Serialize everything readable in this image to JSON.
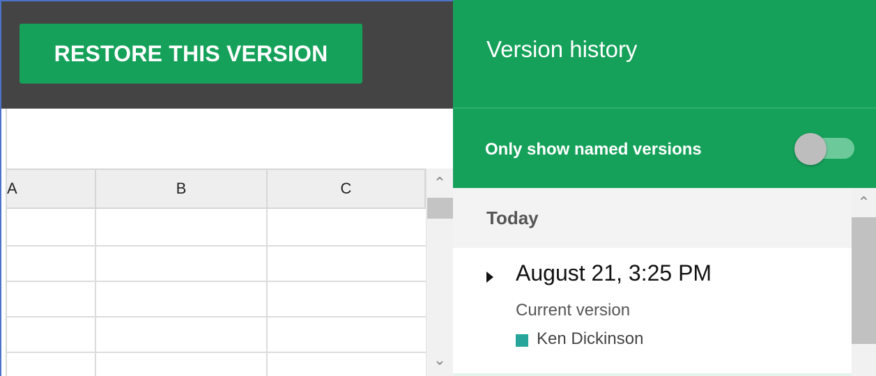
{
  "toolbar": {
    "restore_label": "RESTORE THIS VERSION"
  },
  "sheet": {
    "columns": [
      "A",
      "B",
      "C"
    ]
  },
  "panel": {
    "title": "Version history",
    "filter": {
      "label": "Only show named versions",
      "enabled": false
    },
    "groups": [
      {
        "label": "Today",
        "versions": [
          {
            "timestamp": "August 21, 3:25 PM",
            "description": "Current version",
            "author": "Ken Dickinson",
            "author_color": "#26a69a"
          }
        ]
      }
    ]
  },
  "icons": {
    "scroll_up": "⌃",
    "scroll_down": "⌄"
  },
  "colors": {
    "accent": "#15a15a",
    "toolbar_bg": "#444444"
  }
}
